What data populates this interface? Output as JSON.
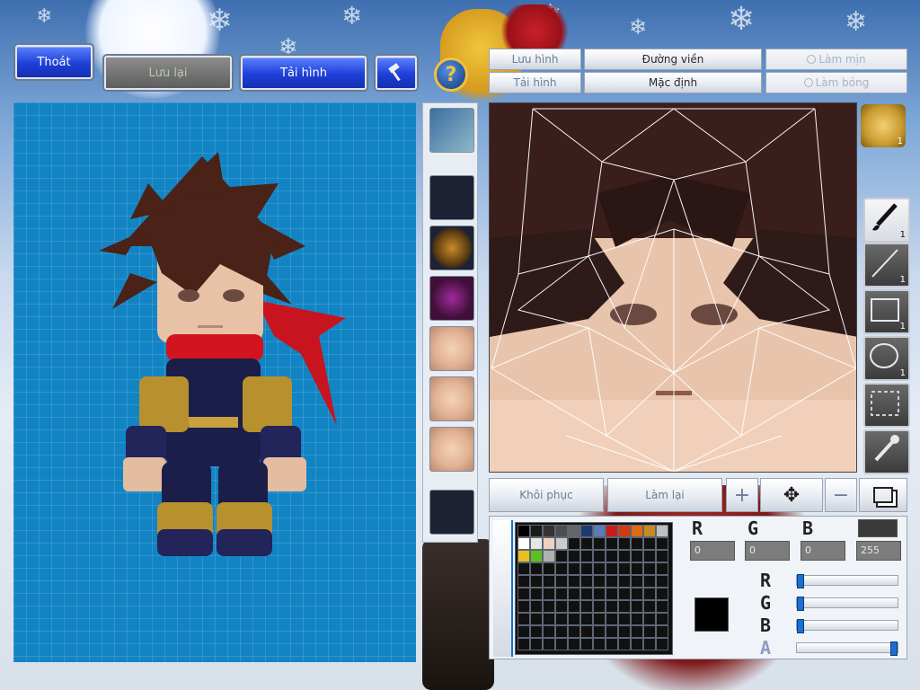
{
  "toolbar": {
    "exit_label": "Thoát",
    "save_label": "Lưu lại",
    "load_label": "Tải hình",
    "tool_icon": "hammer-icon"
  },
  "help_icon": "question-icon",
  "editor_buttons": {
    "save_image": "Lưu hình",
    "load_image": "Tải hình",
    "outline": "Đường viền",
    "default": "Mặc định",
    "smooth": "Làm mịn",
    "shading": "Làm bóng"
  },
  "bottom_buttons": {
    "restore": "Khôi phục",
    "redo": "Làm lại"
  },
  "tools": [
    {
      "name": "brush-tool",
      "count": "1"
    },
    {
      "name": "line-tool",
      "count": "1"
    },
    {
      "name": "rect-tool",
      "count": "1"
    },
    {
      "name": "ellipse-tool",
      "count": "1"
    },
    {
      "name": "select-tool",
      "count": ""
    },
    {
      "name": "eyedropper-tool",
      "count": ""
    }
  ],
  "avatar_badge": "1",
  "channels": {
    "r_label": "R",
    "g_label": "G",
    "b_label": "B",
    "r_value": "0",
    "g_value": "0",
    "b_value": "0",
    "a_value": "255"
  },
  "sliders": {
    "r_label": "R",
    "g_label": "G",
    "b_label": "B",
    "a_label": "A",
    "r_fraction": 0,
    "g_fraction": 0,
    "b_fraction": 0,
    "a_fraction": 1
  },
  "selected_color": "#000000",
  "palette_colors": [
    "#000000",
    "#1a1a1a",
    "#333333",
    "#4d4d4d",
    "#666666",
    "#1e3a6e",
    "#5a7db5",
    "#cc1a1a",
    "#d13a10",
    "#e06a10",
    "#c78a20",
    "#bfbfbf",
    "#ffffff",
    "#e6e6e6",
    "#f2d0c0",
    "#cccccc"
  ],
  "palette_colors_row3": [
    "#e8c020",
    "#5cc020",
    "#b0b0b0"
  ]
}
